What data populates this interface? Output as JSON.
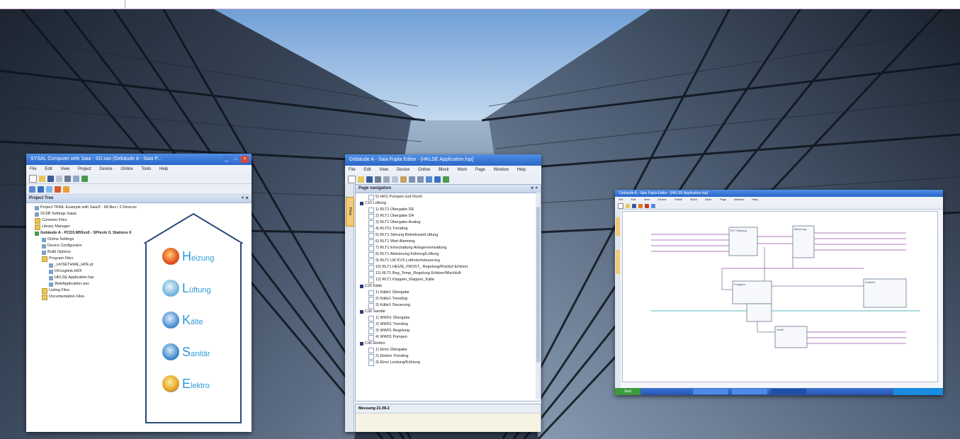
{
  "colors": {
    "accent": "#2e9ad6",
    "titlebar": "#2a66c8",
    "sky": "#9cc0e6"
  },
  "window1": {
    "title": "SYSAL Computer with Saia - SD.sas (Gebäude A - Saia P...",
    "menu": [
      "File",
      "Edit",
      "View",
      "Project",
      "Device",
      "Online",
      "Tools",
      "Help"
    ],
    "panel_title": "Project Tree",
    "tree": [
      {
        "text": "Project TRAIL Example with Saia® - 68 files / 2 Devices",
        "level": 0,
        "icon": "doc",
        "bold": false
      },
      {
        "text": "SC6B Settings Saias",
        "level": 0,
        "icon": "doc",
        "bold": false
      },
      {
        "text": "Common Files",
        "level": 0,
        "icon": "folder",
        "bold": false
      },
      {
        "text": "Library Manager",
        "level": 0,
        "icon": "folder",
        "bold": false
      },
      {
        "text": "Gebäude A - PCD3.M55xx0 - SPlexin 0, Stations 0",
        "level": 0,
        "icon": "device",
        "bold": true
      },
      {
        "text": "Online Settings",
        "level": 1,
        "icon": "doc",
        "bold": false
      },
      {
        "text": "Device Configurator",
        "level": 1,
        "icon": "doc",
        "bold": false
      },
      {
        "text": "Build Options",
        "level": 1,
        "icon": "doc",
        "bold": false
      },
      {
        "text": "Program Files",
        "level": 1,
        "icon": "folder",
        "bold": false
      },
      {
        "text": "_HVSETHWE_HPE.pt",
        "level": 2,
        "icon": "doc",
        "bold": false
      },
      {
        "text": "HVcogHsk.HDF",
        "level": 2,
        "icon": "doc",
        "bold": false
      },
      {
        "text": "HKLSE Application.fup",
        "level": 2,
        "icon": "doc",
        "bold": false
      },
      {
        "text": "WebApplication.wsc",
        "level": 2,
        "icon": "doc",
        "bold": false
      },
      {
        "text": "Listing Files",
        "level": 1,
        "icon": "folder",
        "bold": false
      },
      {
        "text": "Documentation Files",
        "level": 1,
        "icon": "folder",
        "bold": false
      }
    ]
  },
  "categories": [
    {
      "initial": "H",
      "rest": "eizung",
      "icon": "flame-icon",
      "color": "#e0501e"
    },
    {
      "initial": "L",
      "rest": "üftung",
      "icon": "air-icon",
      "color": "#6fb4dc"
    },
    {
      "initial": "K",
      "rest": "älte",
      "icon": "snowflake-icon",
      "color": "#4a8cd0"
    },
    {
      "initial": "S",
      "rest": "anitär",
      "icon": "water-icon",
      "color": "#3a86c8"
    },
    {
      "initial": "E",
      "rest": "lektro",
      "icon": "lightning-icon",
      "color": "#e6a21e"
    }
  ],
  "window2": {
    "title": "Gebäude A - Saia Fupla Editor - [HKLSE Application.fup]",
    "menu": [
      "File",
      "Edit",
      "View",
      "Device",
      "Online",
      "Block",
      "Work",
      "Page",
      "Window",
      "Help"
    ],
    "side_tab": "Fbox",
    "panel_title": "Page navigation",
    "tree": [
      {
        "text": "5) HKS Pumpen und Rückl",
        "level": 2,
        "marker": "leaf"
      },
      {
        "text": "C10 Lüftung",
        "level": 1,
        "marker": "folder"
      },
      {
        "text": "1) RLT1 Übergabe DE",
        "level": 2,
        "marker": "leaf"
      },
      {
        "text": "2) RLT1 Übergabe DA",
        "level": 2,
        "marker": "leaf"
      },
      {
        "text": "3) RLT1 Übergabe Analog",
        "level": 2,
        "marker": "leaf"
      },
      {
        "text": "4) RLT01 Trending",
        "level": 2,
        "marker": "leaf"
      },
      {
        "text": "5) RLT1 Störung Betriebsart/Lüftung",
        "level": 2,
        "marker": "leaf"
      },
      {
        "text": "6) RLT1 Wert Alarming",
        "level": 2,
        "marker": "leaf"
      },
      {
        "text": "7) RLT1 Einschaltung Anlagenverwaltung",
        "level": 2,
        "marker": "leaf"
      },
      {
        "text": "8) RLT1 Aktivierung Kühlung/Lüftung",
        "level": 2,
        "marker": "leaf"
      },
      {
        "text": "9) RLT1 LW KVS Luftmischsteuerung",
        "level": 2,
        "marker": "leaf"
      },
      {
        "text": "10) RLT1 HEIZE_FROST_ Regelung/Rückluf Erhitzer",
        "level": 2,
        "marker": "leaf"
      },
      {
        "text": "11) RLT1 Reg_Temp_Regelung Erhitzer/Mischluft",
        "level": 2,
        "marker": "leaf"
      },
      {
        "text": "12) RLT1 Klappen_Klappen_Kälte",
        "level": 2,
        "marker": "leaf"
      },
      {
        "text": "C20 Kälte",
        "level": 1,
        "marker": "folder"
      },
      {
        "text": "1) Kälte1 Übergabe",
        "level": 2,
        "marker": "leaf"
      },
      {
        "text": "2) Kälte1 Trending",
        "level": 2,
        "marker": "leaf"
      },
      {
        "text": "3) Kälte1 Steuerung",
        "level": 2,
        "marker": "leaf"
      },
      {
        "text": "C30 Sanitär",
        "level": 1,
        "marker": "folder"
      },
      {
        "text": "1) WW01 Übergabe",
        "level": 2,
        "marker": "leaf"
      },
      {
        "text": "2) WW01 Trending",
        "level": 2,
        "marker": "leaf"
      },
      {
        "text": "3) WW01 Regelung",
        "level": 2,
        "marker": "leaf"
      },
      {
        "text": "4) WW01 Pumpen",
        "level": 2,
        "marker": "leaf"
      },
      {
        "text": "C40 Elektro",
        "level": 1,
        "marker": "folder"
      },
      {
        "text": "1) Elmo Übergabe",
        "level": 2,
        "marker": "leaf"
      },
      {
        "text": "2) Elektro Trending",
        "level": 2,
        "marker": "leaf"
      },
      {
        "text": "3) Elmo Leistung/Kühlung",
        "level": 2,
        "marker": "leaf"
      }
    ],
    "bottom_label": "Messung 21.08.2"
  },
  "window3": {
    "title": "Gebäude A - Saia Fupla Editor - [HKLSE Application.fup]",
    "menu": [
      "File",
      "Edit",
      "View",
      "Device",
      "Online",
      "Block",
      "Work",
      "Page",
      "Window",
      "Help"
    ],
    "blocks": [
      "RLT Stellung",
      "Mischung",
      "Freigabe",
      "Sollwert",
      "Ventil"
    ],
    "start_label": "Start"
  }
}
